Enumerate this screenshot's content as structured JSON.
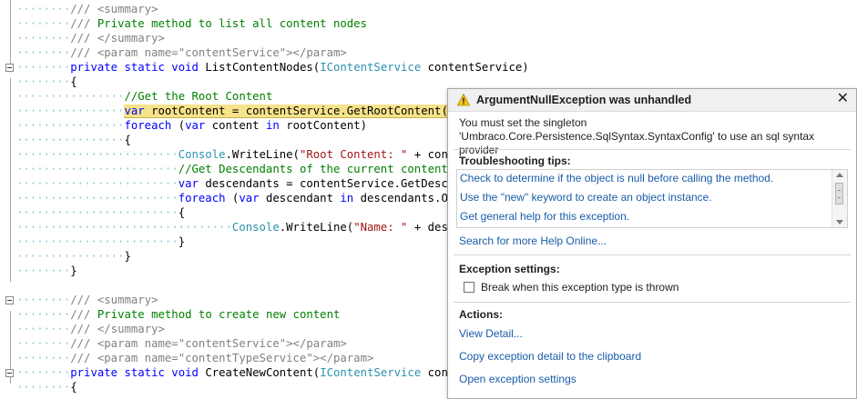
{
  "editor": {
    "lines": [
      {
        "indent": 1,
        "parts": [
          [
            "xd",
            "/// "
          ],
          [
            "xd",
            "<summary>"
          ]
        ]
      },
      {
        "indent": 1,
        "parts": [
          [
            "xd",
            "/// "
          ],
          [
            "cm",
            "Private method to list all content nodes"
          ]
        ]
      },
      {
        "indent": 1,
        "parts": [
          [
            "xd",
            "/// "
          ],
          [
            "xd",
            "</summary>"
          ]
        ]
      },
      {
        "indent": 1,
        "parts": [
          [
            "xd",
            "/// "
          ],
          [
            "xd",
            "<param name=\"contentService\"></param>"
          ]
        ]
      },
      {
        "indent": 1,
        "fold": true,
        "parts": [
          [
            "kw",
            "private "
          ],
          [
            "kw",
            "static "
          ],
          [
            "kw",
            "void "
          ],
          [
            "",
            "ListContentNodes("
          ],
          [
            "ty",
            "IContentService "
          ],
          [
            "",
            "contentService)"
          ]
        ]
      },
      {
        "indent": 1,
        "parts": [
          [
            "",
            "{"
          ]
        ]
      },
      {
        "indent": 2,
        "parts": [
          [
            "cm",
            "//Get the Root Content"
          ]
        ]
      },
      {
        "indent": 2,
        "highlight": true,
        "parts": [
          [
            "kw",
            "var "
          ],
          [
            "",
            "rootContent = contentService.GetRootContent();"
          ]
        ]
      },
      {
        "indent": 2,
        "parts": [
          [
            "kw",
            "foreach "
          ],
          [
            "",
            "("
          ],
          [
            "kw",
            "var "
          ],
          [
            "",
            "content "
          ],
          [
            "kw",
            "in "
          ],
          [
            "",
            "rootContent)"
          ]
        ]
      },
      {
        "indent": 2,
        "parts": [
          [
            "",
            "{"
          ]
        ]
      },
      {
        "indent": 3,
        "parts": [
          [
            "ty",
            "Console"
          ],
          [
            "",
            ".WriteLine("
          ],
          [
            "st",
            "\"Root Content: \""
          ],
          [
            "",
            " + content.Name + "
          ]
        ]
      },
      {
        "indent": 3,
        "parts": [
          [
            "cm",
            "//Get Descendants of the current content and write i"
          ]
        ]
      },
      {
        "indent": 3,
        "parts": [
          [
            "kw",
            "var "
          ],
          [
            "",
            "descendants = contentService.GetDescendants(con"
          ]
        ]
      },
      {
        "indent": 3,
        "parts": [
          [
            "kw",
            "foreach "
          ],
          [
            "",
            "("
          ],
          [
            "kw",
            "var "
          ],
          [
            "",
            "descendant "
          ],
          [
            "kw",
            "in "
          ],
          [
            "",
            "descendants.OrderBy(x => "
          ]
        ]
      },
      {
        "indent": 3,
        "parts": [
          [
            "",
            "{"
          ]
        ]
      },
      {
        "indent": 4,
        "parts": [
          [
            "ty",
            "Console"
          ],
          [
            "",
            ".WriteLine("
          ],
          [
            "st",
            "\"Name: \""
          ],
          [
            "",
            " + descendant.Name + "
          ]
        ]
      },
      {
        "indent": 3,
        "parts": [
          [
            "",
            "}"
          ]
        ]
      },
      {
        "indent": 2,
        "parts": [
          [
            "",
            "}"
          ]
        ]
      },
      {
        "indent": 1,
        "parts": [
          [
            "",
            "}"
          ]
        ]
      },
      {
        "indent": 0,
        "parts": [
          [
            "",
            ""
          ]
        ]
      },
      {
        "indent": 1,
        "fold": true,
        "parts": [
          [
            "xd",
            "/// "
          ],
          [
            "xd",
            "<summary>"
          ]
        ]
      },
      {
        "indent": 1,
        "parts": [
          [
            "xd",
            "/// "
          ],
          [
            "cm",
            "Private method to create new content"
          ]
        ]
      },
      {
        "indent": 1,
        "parts": [
          [
            "xd",
            "/// "
          ],
          [
            "xd",
            "</summary>"
          ]
        ]
      },
      {
        "indent": 1,
        "parts": [
          [
            "xd",
            "/// "
          ],
          [
            "xd",
            "<param name=\"contentService\"></param>"
          ]
        ]
      },
      {
        "indent": 1,
        "parts": [
          [
            "xd",
            "/// "
          ],
          [
            "xd",
            "<param name=\"contentTypeService\"></param>"
          ]
        ]
      },
      {
        "indent": 1,
        "fold": true,
        "parts": [
          [
            "kw",
            "private "
          ],
          [
            "kw",
            "static "
          ],
          [
            "kw",
            "void "
          ],
          [
            "",
            "CreateNewContent("
          ],
          [
            "ty",
            "IContentService "
          ],
          [
            "",
            "content"
          ]
        ]
      },
      {
        "indent": 1,
        "parts": [
          [
            "",
            "{"
          ]
        ]
      }
    ]
  },
  "exception_popup": {
    "title": "ArgumentNullException was unhandled",
    "message": "You must set the singleton 'Umbraco.Core.Persistence.SqlSyntax.SyntaxConfig' to use an sql syntax provider",
    "tips_heading": "Troubleshooting tips:",
    "tips": [
      "Check to determine if the object is null before calling the method.",
      "Use the \"new\" keyword to create an object instance.",
      "Get general help for this exception."
    ],
    "search_link": "Search for more Help Online...",
    "settings_heading": "Exception settings:",
    "break_checkbox_label": "Break when this exception type is thrown",
    "break_checked": false,
    "actions_heading": "Actions:",
    "actions": [
      "View Detail...",
      "Copy exception detail to the clipboard",
      "Open exception settings"
    ]
  }
}
